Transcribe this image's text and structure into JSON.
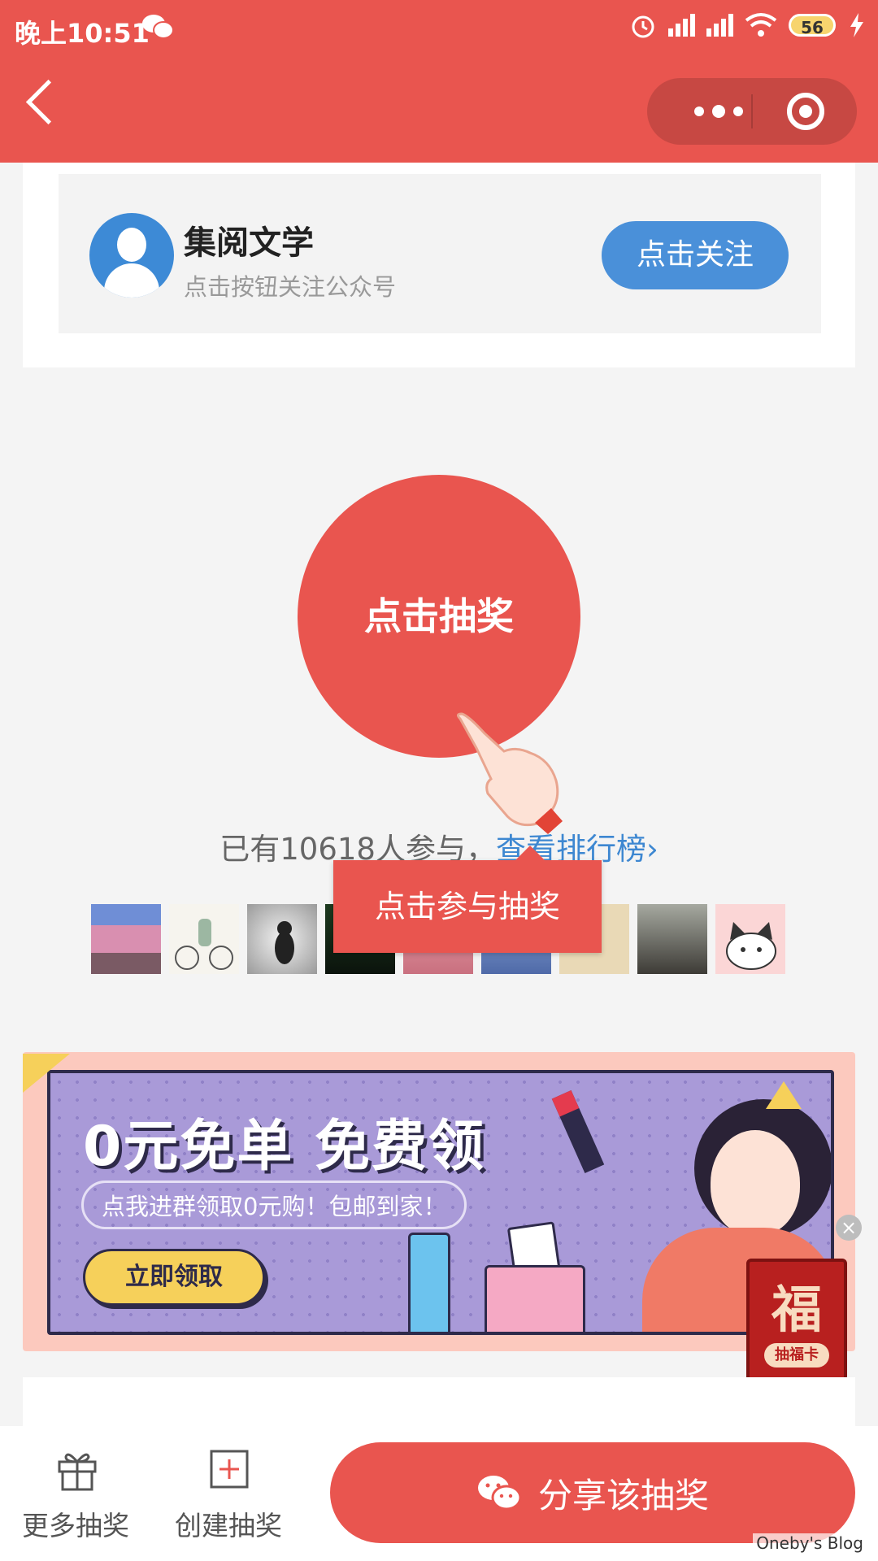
{
  "status_bar": {
    "time": "晚上10:51",
    "battery": "56"
  },
  "account": {
    "name": "集阅文学",
    "subtitle": "点击按钮关注公众号",
    "follow_label": "点击关注"
  },
  "draw": {
    "button_label": "点击抽奖",
    "participants_prefix": "已有10618人参与，",
    "leaderboard_link": "查看排行榜",
    "leaderboard_chevron": "›",
    "tooltip": "点击参与抽奖"
  },
  "banner": {
    "title": "0元免单 免费领",
    "subtitle": "点我进群领取0元购！包邮到家！",
    "button": "立即领取"
  },
  "fu_card": {
    "char": "福",
    "label": "抽福卡",
    "close": "×"
  },
  "bottom_bar": {
    "more_label": "更多抽奖",
    "create_label": "创建抽奖",
    "share_label": "分享该抽奖"
  },
  "watermark": "Oneby's Blog",
  "colors": {
    "primary": "#e9554f",
    "link": "#3d87d1",
    "follow": "#4a90d9"
  }
}
